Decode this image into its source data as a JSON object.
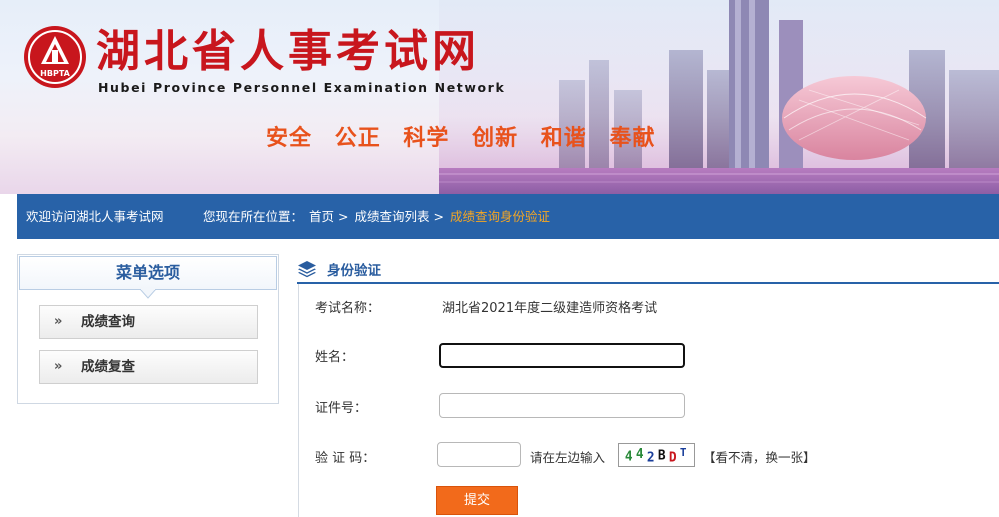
{
  "banner": {
    "site_title": "湖北省人事考试网",
    "site_subtitle": "Hubei Province Personnel Examination Network",
    "seal_text": "HBPTA",
    "slogan": [
      "安全",
      "公正",
      "科学",
      "创新",
      "和谐",
      "奉献"
    ]
  },
  "navbar": {
    "welcome": "欢迎访问湖北人事考试网",
    "location_label": "您现在所在位置：",
    "breadcrumb": [
      "首页",
      "成绩查询列表",
      "成绩查询身份验证"
    ],
    "separator": ">"
  },
  "sidebar": {
    "heading": "菜单选项",
    "items": [
      {
        "chevron": "»",
        "label": "成绩查询"
      },
      {
        "chevron": "»",
        "label": "成绩复查"
      }
    ]
  },
  "panel": {
    "title": "身份验证",
    "icon": "layers-icon"
  },
  "form": {
    "exam_label": "考试名称：",
    "exam_name": "湖北省2021年度二级建造师资格考试",
    "name_label": "姓名：",
    "name_value": "",
    "id_label": "证件号：",
    "id_value": "",
    "captcha_label": "验 证 码：",
    "captcha_value": "",
    "captcha_hint": "请在左边输入",
    "captcha_chars": [
      "4",
      "4",
      "2",
      "B",
      "D",
      "T"
    ],
    "captcha_colors": [
      "#2a8a3a",
      "#2a8a3a",
      "#1a3e9a",
      "#111111",
      "#c8161d",
      "#1a3e9a"
    ],
    "refresh_text": "【看不清，换一张】",
    "submit_label": "提交"
  },
  "colors": {
    "nav_bg": "#2862a8",
    "accent_orange": "#f26a1b",
    "title_red": "#c8161d",
    "breadcrumb_current": "#f5a623"
  }
}
